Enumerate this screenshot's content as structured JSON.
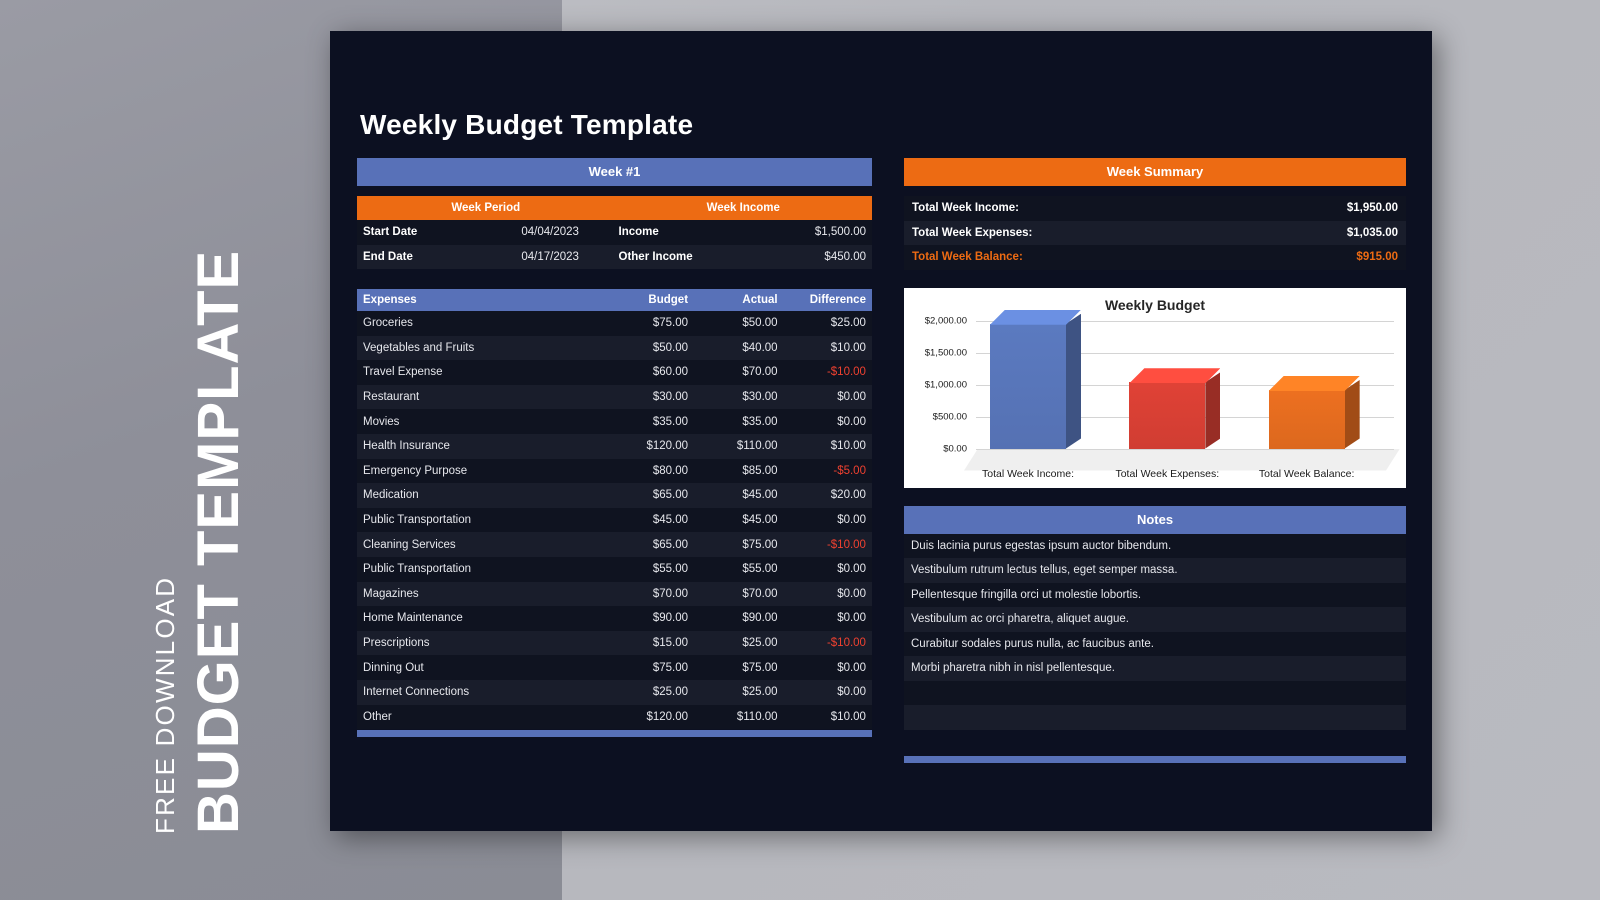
{
  "promo": {
    "main": "BUDGET TEMPLATE",
    "sub": "FREE DOWNLOAD"
  },
  "document": {
    "title": "Weekly Budget Template",
    "week_header": "Week #1",
    "week_period": {
      "col_period_header": "Week Period",
      "col_income_header": "Week Income",
      "rows": [
        {
          "label": "Start Date",
          "value": "04/04/2023",
          "label2": "Income",
          "value2": "$1,500.00"
        },
        {
          "label": "End Date",
          "value": "04/17/2023",
          "label2": "Other Income",
          "value2": "$450.00"
        }
      ]
    },
    "expenses": {
      "headers": [
        "Expenses",
        "Budget",
        "Actual",
        "Difference"
      ],
      "rows": [
        {
          "name": "Groceries",
          "budget": "$75.00",
          "actual": "$50.00",
          "diff": "$25.00",
          "negative": false
        },
        {
          "name": "Vegetables and Fruits",
          "budget": "$50.00",
          "actual": "$40.00",
          "diff": "$10.00",
          "negative": false
        },
        {
          "name": "Travel Expense",
          "budget": "$60.00",
          "actual": "$70.00",
          "diff": "-$10.00",
          "negative": true
        },
        {
          "name": "Restaurant",
          "budget": "$30.00",
          "actual": "$30.00",
          "diff": "$0.00",
          "negative": false
        },
        {
          "name": "Movies",
          "budget": "$35.00",
          "actual": "$35.00",
          "diff": "$0.00",
          "negative": false
        },
        {
          "name": "Health Insurance",
          "budget": "$120.00",
          "actual": "$110.00",
          "diff": "$10.00",
          "negative": false
        },
        {
          "name": "Emergency Purpose",
          "budget": "$80.00",
          "actual": "$85.00",
          "diff": "-$5.00",
          "negative": true
        },
        {
          "name": "Medication",
          "budget": "$65.00",
          "actual": "$45.00",
          "diff": "$20.00",
          "negative": false
        },
        {
          "name": "Public Transportation",
          "budget": "$45.00",
          "actual": "$45.00",
          "diff": "$0.00",
          "negative": false
        },
        {
          "name": "Cleaning Services",
          "budget": "$65.00",
          "actual": "$75.00",
          "diff": "-$10.00",
          "negative": true
        },
        {
          "name": "Public Transportation",
          "budget": "$55.00",
          "actual": "$55.00",
          "diff": "$0.00",
          "negative": false
        },
        {
          "name": "Magazines",
          "budget": "$70.00",
          "actual": "$70.00",
          "diff": "$0.00",
          "negative": false
        },
        {
          "name": "Home Maintenance",
          "budget": "$90.00",
          "actual": "$90.00",
          "diff": "$0.00",
          "negative": false
        },
        {
          "name": "Prescriptions",
          "budget": "$15.00",
          "actual": "$25.00",
          "diff": "-$10.00",
          "negative": true
        },
        {
          "name": "Dinning Out",
          "budget": "$75.00",
          "actual": "$75.00",
          "diff": "$0.00",
          "negative": false
        },
        {
          "name": "Internet Connections",
          "budget": "$25.00",
          "actual": "$25.00",
          "diff": "$0.00",
          "negative": false
        },
        {
          "name": "Other",
          "budget": "$120.00",
          "actual": "$110.00",
          "diff": "$10.00",
          "negative": false
        }
      ]
    },
    "summary": {
      "header": "Week Summary",
      "rows": [
        {
          "label": "Total Week Income:",
          "value": "$1,950.00",
          "accent": false
        },
        {
          "label": "Total Week Expenses:",
          "value": "$1,035.00",
          "accent": false
        },
        {
          "label": "Total Week Balance:",
          "value": "$915.00",
          "accent": true
        }
      ]
    },
    "notes": {
      "header": "Notes",
      "items": [
        "Duis lacinia purus egestas ipsum auctor bibendum.",
        "Vestibulum rutrum lectus tellus, eget semper massa.",
        "Pellentesque fringilla orci ut molestie lobortis.",
        "Vestibulum ac orci pharetra, aliquet augue.",
        "Curabitur sodales purus nulla, ac faucibus ante.",
        "Morbi pharetra nibh in nisl pellentesque.",
        "",
        ""
      ]
    }
  },
  "colors": {
    "blue": "#5871b8",
    "orange": "#ed6b13",
    "negative_red": "#ee4130",
    "panel_dark": "#0c1021",
    "row_dark": "#0f1320",
    "row_light": "#191d2b"
  },
  "chart_data": {
    "type": "bar",
    "title": "Weekly Budget",
    "categories": [
      "Total Week Income:",
      "Total Week Expenses:",
      "Total Week Balance:"
    ],
    "values": [
      1950,
      1035,
      915
    ],
    "colors": [
      "#5b7ac0",
      "#e04236",
      "#ed7020"
    ],
    "xlabel": "",
    "ylabel": "",
    "ylim": [
      0,
      2000
    ],
    "yticks": [
      0,
      500,
      1000,
      1500,
      2000
    ],
    "ytick_labels": [
      "$0.00",
      "$500.00",
      "$1,000.00",
      "$1,500.00",
      "$2,000.00"
    ],
    "grid": true,
    "legend": false,
    "style": "3d-column"
  }
}
